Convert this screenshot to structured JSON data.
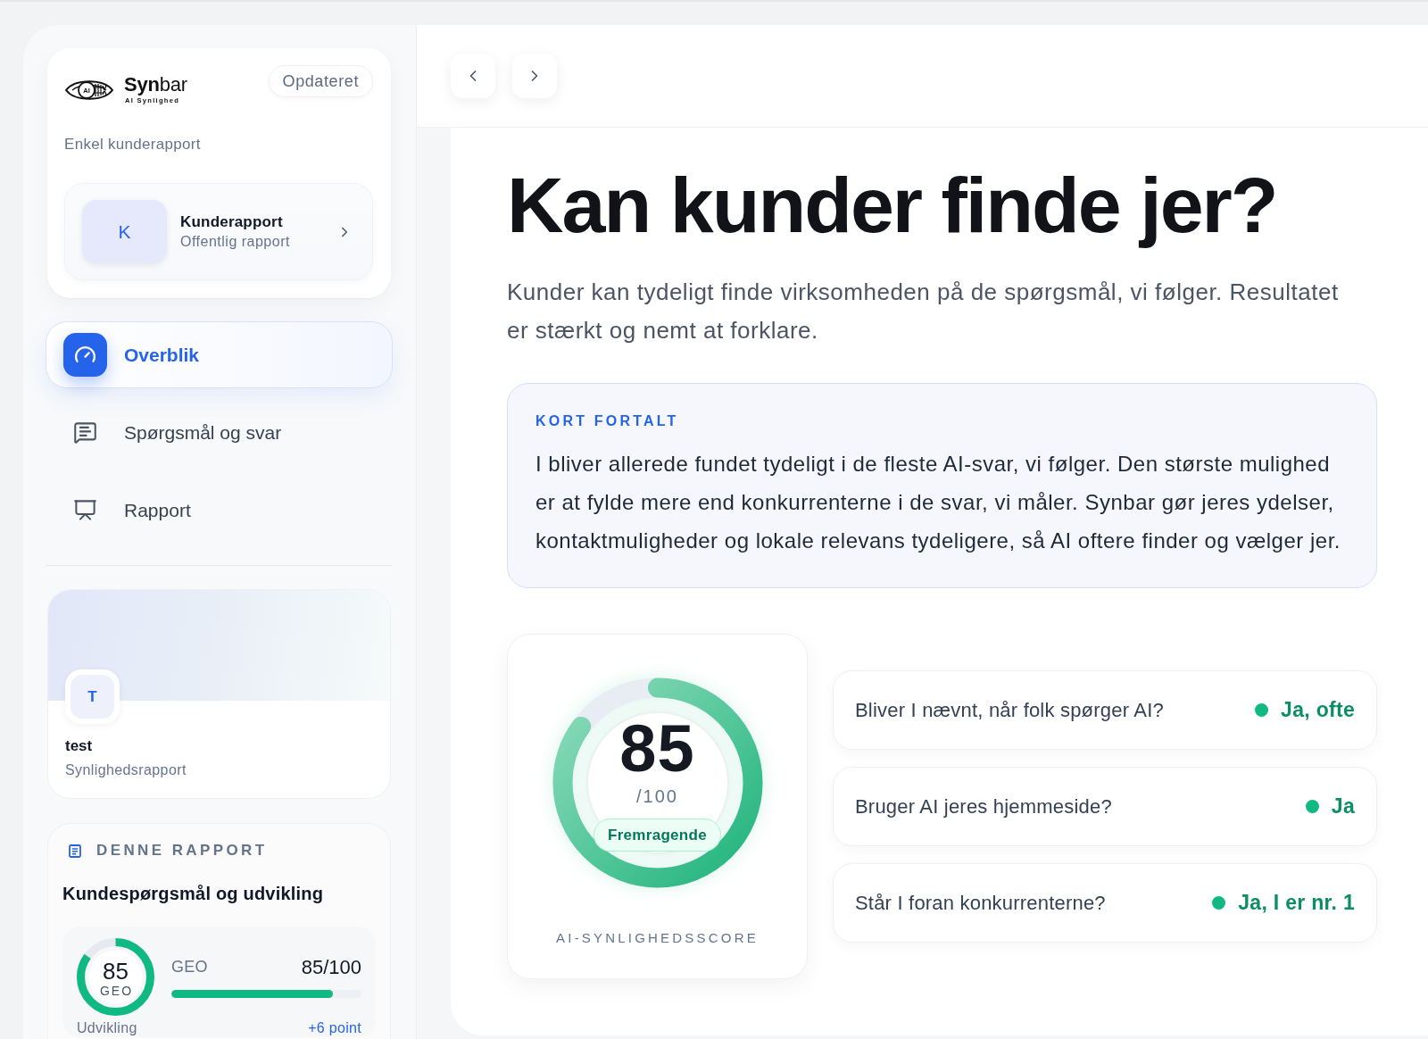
{
  "sidebar": {
    "brand": {
      "logo_text": "AI",
      "name": "**Syn**bar",
      "tagline": "AI Synlighed"
    },
    "status": "Opdateret",
    "subtitle": "Enkel kunderapport",
    "report_link": {
      "initial": "K",
      "title": "Kunderapport",
      "subtitle": "Offentlig rapport"
    },
    "nav": [
      {
        "label": "Overblik",
        "selected": true
      },
      {
        "label": "Spørgsmål og svar",
        "selected": false
      },
      {
        "label": "Rapport",
        "selected": false
      }
    ],
    "profile": {
      "initial": "T",
      "name": "test",
      "subtitle": "Synlighedsrapport"
    },
    "report_card": {
      "heading": "DENNE RAPPORT",
      "title": "Kundespørgsmål og udvikling",
      "score": {
        "value": "85",
        "label": "GEO",
        "level": 0.85
      },
      "metric": {
        "label": "GEO",
        "reading": "85/100",
        "level": 0.85
      },
      "trend": {
        "label": "Udvikling",
        "value": "+6 point"
      }
    }
  },
  "main": {
    "heading": "Kan kunder finde jer?",
    "intro": "Kunder kan tydeligt finde virksomheden på de spørgsmål, vi følger. Resultatet er stærkt og nemt at forklare.",
    "summary": {
      "label": "KORT FORTALT",
      "text": "I bliver allerede fundet tydeligt i de fleste AI-svar, vi følger. Den største mulighed er at fylde mere end konkurrenterne i de svar, vi måler. Synbar gør jeres ydelser, kontaktmuligheder og lokale relevans tydeligere, så AI oftere finder og vælger jer."
    },
    "score": {
      "value": "85",
      "scale": "/100",
      "rating": "Fremragende",
      "caption": "AI-SYNLIGHEDSSCORE",
      "level": 0.85
    },
    "checks": [
      {
        "question": "Bliver I nævnt, når folk spørger AI?",
        "answer": "Ja, ofte"
      },
      {
        "question": "Bruger AI jeres hjemmeside?",
        "answer": "Ja"
      },
      {
        "question": "Står I foran konkurrenterne?",
        "answer": "Ja, I er nr. 1"
      }
    ]
  }
}
